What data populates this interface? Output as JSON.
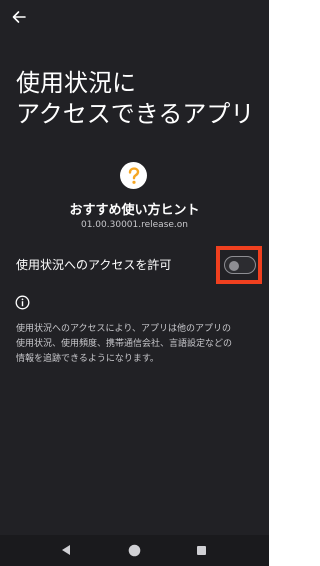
{
  "header": {
    "back_icon": "arrow-left-icon"
  },
  "title": {
    "line1": "使用状況に",
    "line2": "アクセスできるアプリ"
  },
  "app": {
    "icon": "question-mark-icon",
    "icon_color": "#F5A623",
    "name": "おすすめ使い方ヒント",
    "version": "01.00.30001.release.on"
  },
  "usage_access": {
    "label": "使用状況へのアクセスを許可",
    "enabled": false,
    "highlight_color": "#F0401F"
  },
  "info": {
    "icon": "info-icon",
    "line1": "使用状況へのアクセスにより、アプリは他のアプリの",
    "line2": "使用状況、使用頻度、携帯通信会社、言語設定などの",
    "line3": "情報を追跡できるようになります。"
  },
  "nav_bar": {
    "back": "triangle-back-icon",
    "home": "circle-home-icon",
    "recents": "square-recents-icon"
  }
}
